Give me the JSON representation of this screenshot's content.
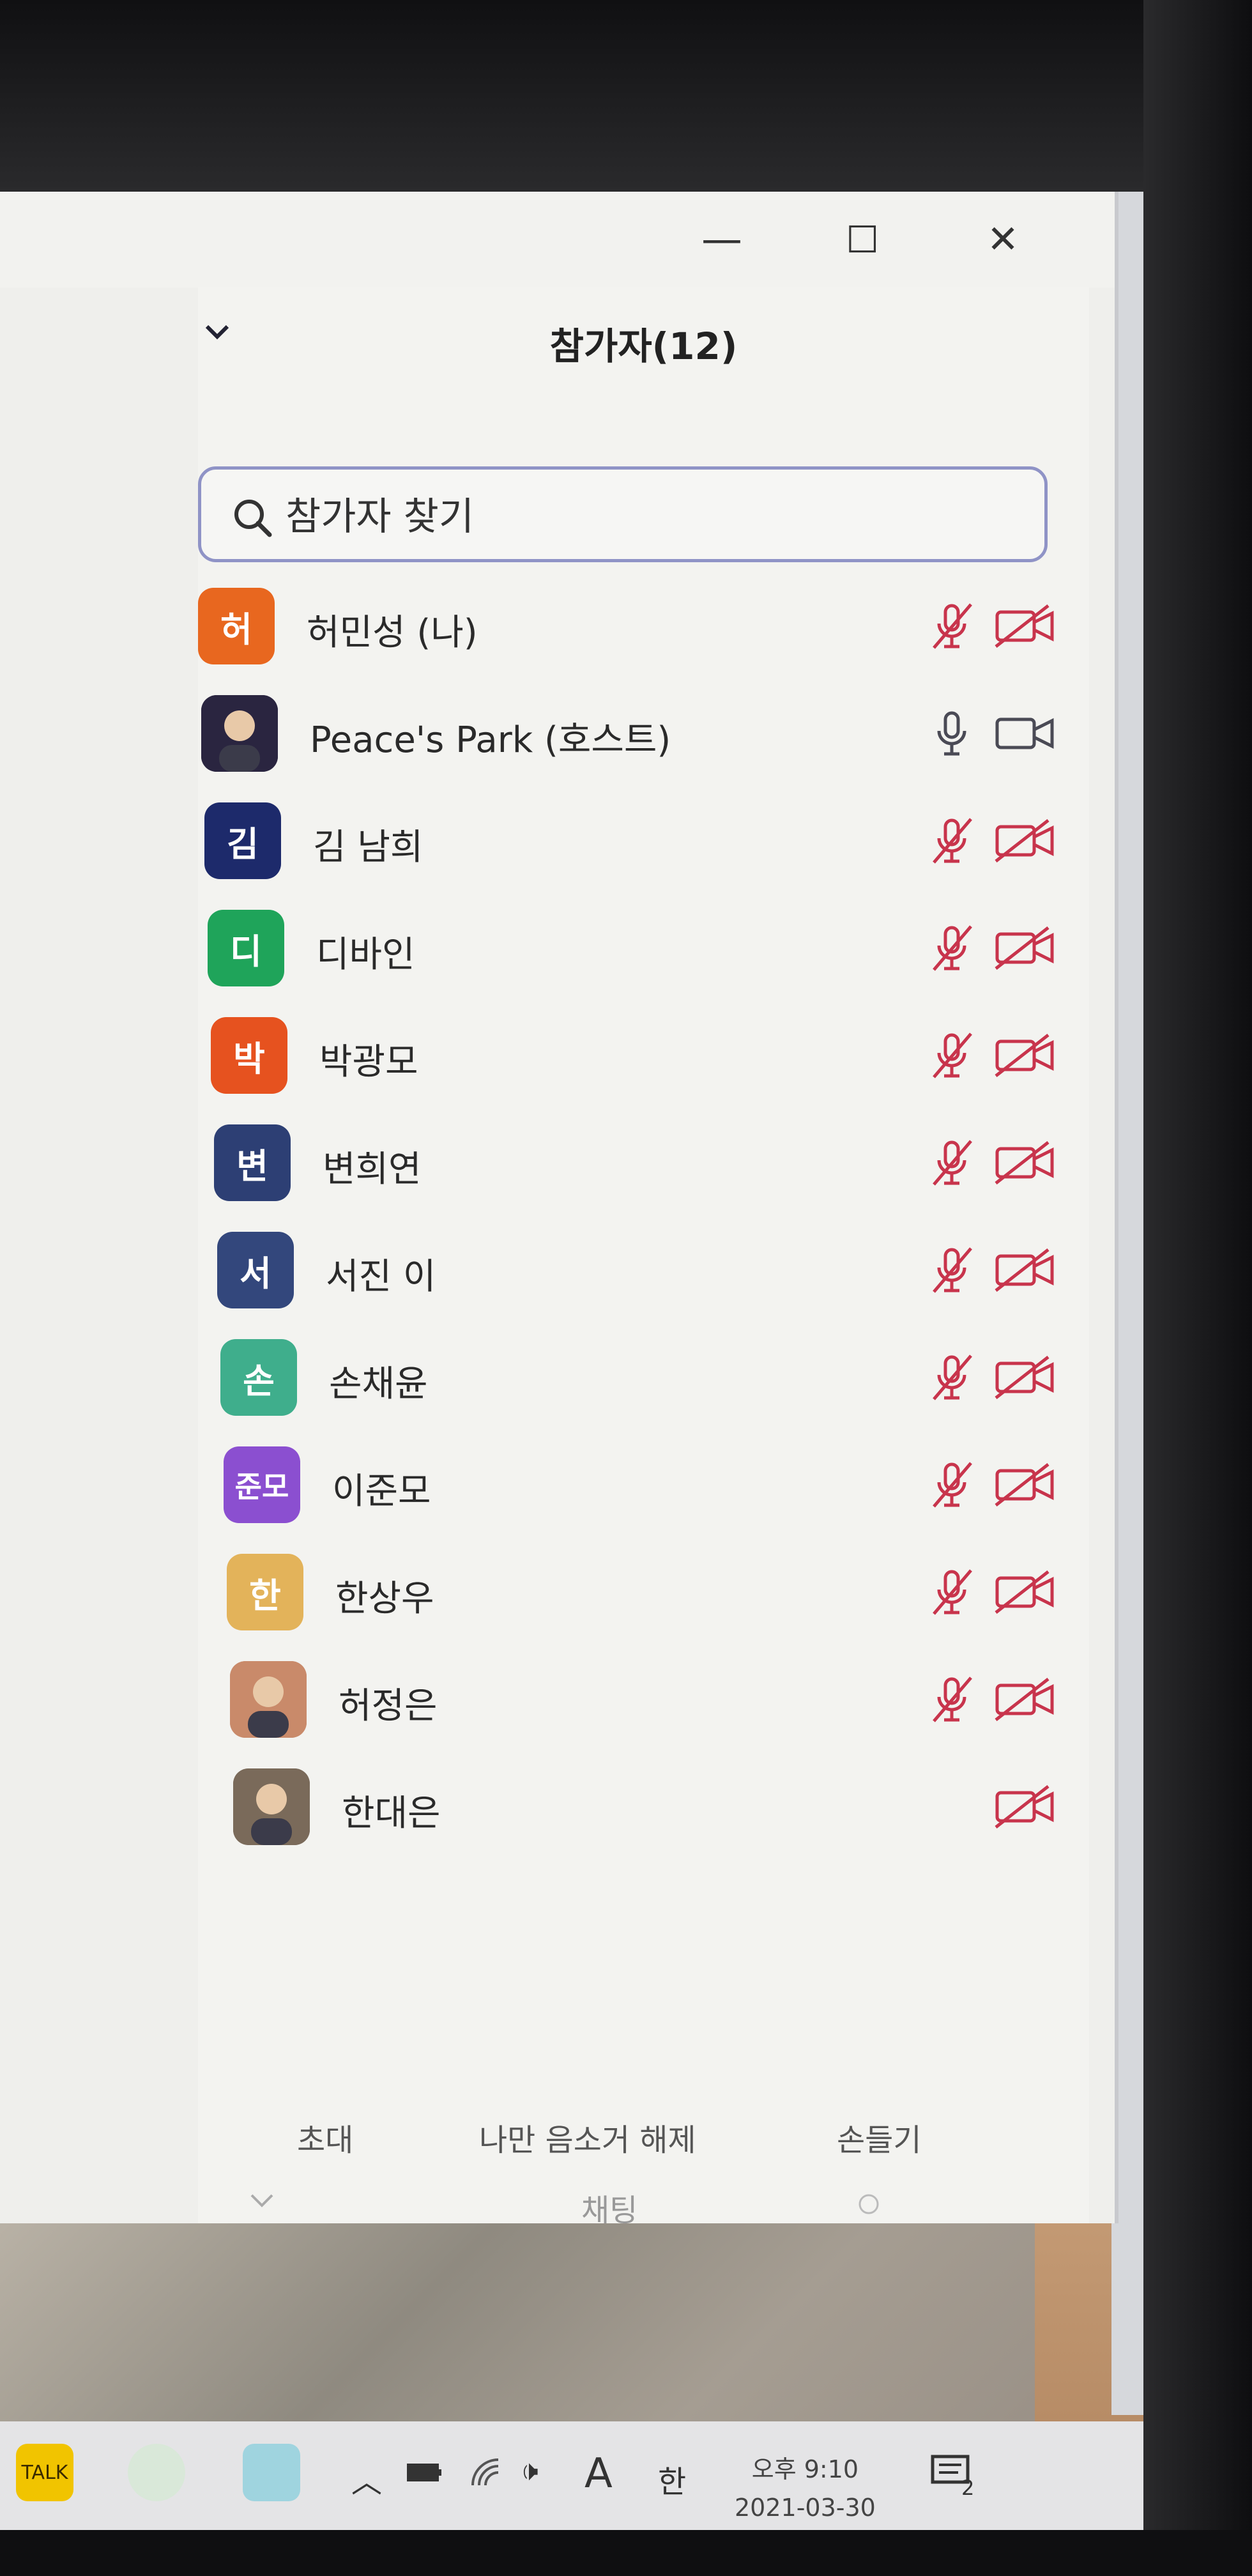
{
  "window": {
    "minimize_symbol": "—",
    "maximize_symbol": "☐",
    "close_symbol": "✕"
  },
  "panel": {
    "title": "참가자(12)",
    "collapse_icon": "chevron-down-icon"
  },
  "search": {
    "placeholder": "참가자 찾기"
  },
  "participants": [
    {
      "initial": "허",
      "name": "허민성 (나)",
      "avatar_color": "#e8671f",
      "mic": "muted",
      "video": "off"
    },
    {
      "initial": "",
      "name": "Peace's Park (호스트)",
      "avatar_color": "#2a2540",
      "mic": "on",
      "video": "on"
    },
    {
      "initial": "김",
      "name": "김 남희",
      "avatar_color": "#1d2a6b",
      "mic": "muted",
      "video": "off"
    },
    {
      "initial": "디",
      "name": "디바인",
      "avatar_color": "#1fa45a",
      "mic": "muted",
      "video": "off"
    },
    {
      "initial": "박",
      "name": "박광모",
      "avatar_color": "#e6521f",
      "mic": "muted",
      "video": "off"
    },
    {
      "initial": "변",
      "name": "변희연",
      "avatar_color": "#2d3f74",
      "mic": "muted",
      "video": "off"
    },
    {
      "initial": "서",
      "name": "서진 이",
      "avatar_color": "#33477c",
      "mic": "muted",
      "video": "off"
    },
    {
      "initial": "손",
      "name": "손채윤",
      "avatar_color": "#3fae8c",
      "mic": "muted",
      "video": "off"
    },
    {
      "initial": "준모",
      "name": "이준모",
      "avatar_color": "#8b4fd0",
      "mic": "muted",
      "video": "off"
    },
    {
      "initial": "한",
      "name": "한상우",
      "avatar_color": "#e3b35a",
      "mic": "muted",
      "video": "off"
    },
    {
      "initial": "",
      "name": "허정은",
      "avatar_color": "#c98a6a",
      "mic": "muted",
      "video": "off"
    },
    {
      "initial": "",
      "name": "한대은",
      "avatar_color": "#7a6a5a",
      "mic": "none",
      "video": "off"
    }
  ],
  "footer": {
    "invite": "초대",
    "unmute_me": "나만 음소거 해제",
    "raise_hand": "손들기",
    "chat": "채팅"
  },
  "colors": {
    "muted_red": "#c8344c",
    "icon_gray": "#4a4a55",
    "search_border": "#8f93c6"
  },
  "taskbar": {
    "talk_label": "TALK",
    "ime_mode": "A",
    "ime_lang": "한",
    "clock_time": "오후 9:10",
    "clock_date": "2021-03-30",
    "notification_count": "2"
  }
}
